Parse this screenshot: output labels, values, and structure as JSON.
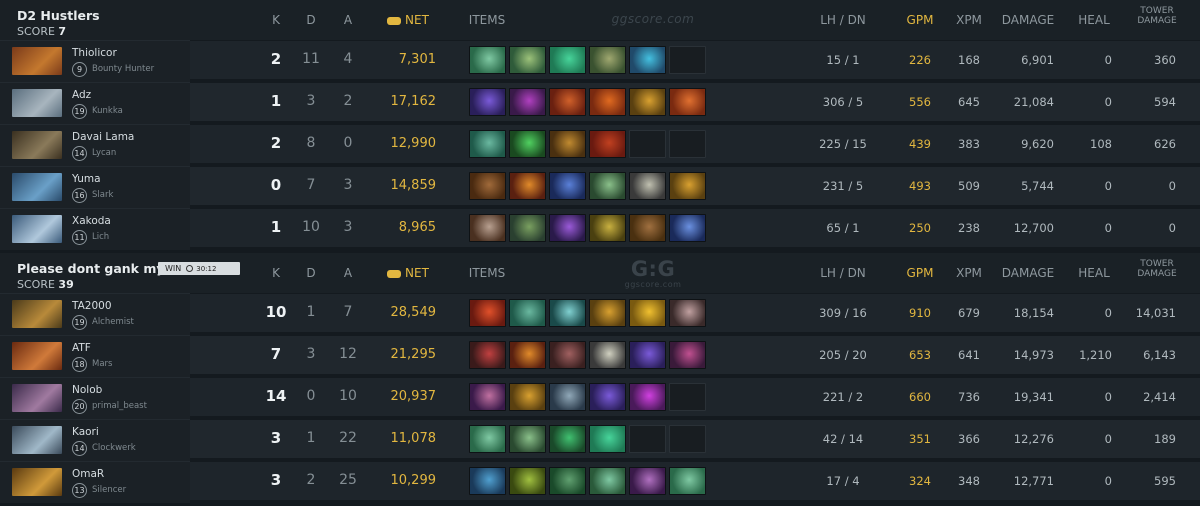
{
  "columns": {
    "k": "K",
    "d": "D",
    "a": "A",
    "net": "NET",
    "items": "ITEMS",
    "lh_dn": "LH  /  DN",
    "gpm": "GPM",
    "xpm": "XPM",
    "damage": "DAMAGE",
    "heal": "HEAL",
    "tower_damage_line1": "TOWER",
    "tower_damage_line2": "DAMAGE"
  },
  "watermark": {
    "top": "ggscore.com",
    "logo": "G:G",
    "logo_sub": "ggscore.com"
  },
  "match": {
    "result": "WIN",
    "duration": "30:12"
  },
  "colors": {
    "gold": "#e2b740",
    "background": "#141a1f",
    "row": "#1e252b"
  },
  "teams": [
    {
      "name": "D2 Hustlers",
      "score_label": "SCORE",
      "score": "7",
      "players": [
        {
          "name": "Thiolicor",
          "level": "9",
          "hero": "Bounty Hunter",
          "k": "2",
          "d": "11",
          "a": "4",
          "net": "7,301",
          "lh_dn": "15  /  1",
          "gpm": "226",
          "xpm": "168",
          "damage": "6,901",
          "heal": "0",
          "tower": "360",
          "portrait_colors": [
            "#7a3a1a",
            "#c4782e"
          ],
          "items": [
            [
              "#2a6a4a",
              "#7fc9a3"
            ],
            [
              "#2f5b3a",
              "#9cc27a"
            ],
            [
              "#1f7a55",
              "#47d49a"
            ],
            [
              "#3a5230",
              "#a0a870"
            ],
            [
              "#204a6a",
              "#44c0e0"
            ],
            null
          ]
        },
        {
          "name": "Adz",
          "level": "19",
          "hero": "Kunkka",
          "k": "1",
          "d": "3",
          "a": "2",
          "net": "17,162",
          "lh_dn": "306  /  5",
          "gpm": "556",
          "xpm": "645",
          "damage": "21,084",
          "heal": "0",
          "tower": "594",
          "portrait_colors": [
            "#5a6e7e",
            "#a8b5be"
          ],
          "items": [
            [
              "#2a1f5a",
              "#7a5ad8"
            ],
            [
              "#3a1a4a",
              "#b040c0"
            ],
            [
              "#6a2010",
              "#d0602a"
            ],
            [
              "#7a2a10",
              "#e06a20"
            ],
            [
              "#5a4010",
              "#d8a030"
            ],
            [
              "#7a2a10",
              "#e07030"
            ]
          ]
        },
        {
          "name": "Davai Lama",
          "level": "14",
          "hero": "Lycan",
          "k": "2",
          "d": "8",
          "a": "0",
          "net": "12,990",
          "lh_dn": "225  /  15",
          "gpm": "439",
          "xpm": "383",
          "damage": "9,620",
          "heal": "108",
          "tower": "626",
          "portrait_colors": [
            "#3a3020",
            "#8a7a5a"
          ],
          "items": [
            [
              "#1f5a4a",
              "#6ab8a0"
            ],
            [
              "#1a4a20",
              "#50d060"
            ],
            [
              "#4a3010",
              "#c08a30"
            ],
            [
              "#6a1a10",
              "#c04020"
            ],
            null,
            null
          ]
        },
        {
          "name": "Yuma",
          "level": "16",
          "hero": "Slark",
          "k": "0",
          "d": "7",
          "a": "3",
          "net": "14,859",
          "lh_dn": "231  /  5",
          "gpm": "493",
          "xpm": "509",
          "damage": "5,744",
          "heal": "0",
          "tower": "0",
          "portrait_colors": [
            "#2a4a6a",
            "#6aa0c8"
          ],
          "items": [
            [
              "#4a2a10",
              "#a06a3a"
            ],
            [
              "#5a2010",
              "#e08a2a"
            ],
            [
              "#1a2a5a",
              "#5a80d8"
            ],
            [
              "#2a4a30",
              "#8ac08a"
            ],
            [
              "#3a3a3a",
              "#c0c0b0"
            ],
            [
              "#5a4010",
              "#d8a030"
            ]
          ]
        },
        {
          "name": "Xakoda",
          "level": "11",
          "hero": "Lich",
          "k": "1",
          "d": "10",
          "a": "3",
          "net": "8,965",
          "lh_dn": "65  /  1",
          "gpm": "250",
          "xpm": "238",
          "damage": "12,700",
          "heal": "0",
          "tower": "0",
          "portrait_colors": [
            "#3a5a7a",
            "#b0c8dc"
          ],
          "items": [
            [
              "#4a3020",
              "#b8a090"
            ],
            [
              "#2a4030",
              "#7aa060"
            ],
            [
              "#2a1a4a",
              "#9a5ad8"
            ],
            [
              "#4a4010",
              "#c8b040"
            ],
            [
              "#4a3010",
              "#a07040"
            ],
            [
              "#1a2a5a",
              "#6a90e0"
            ]
          ]
        }
      ]
    },
    {
      "name": "Please dont gank my carry",
      "score_label": "SCORE",
      "score": "39",
      "players": [
        {
          "name": "TA2000",
          "level": "19",
          "hero": "Alchemist",
          "k": "10",
          "d": "1",
          "a": "7",
          "net": "28,549",
          "lh_dn": "309  /  16",
          "gpm": "910",
          "xpm": "679",
          "damage": "18,154",
          "heal": "0",
          "tower": "14,031",
          "portrait_colors": [
            "#4a3a1a",
            "#b88a3a"
          ],
          "items": [
            [
              "#6a1a10",
              "#e0502a"
            ],
            [
              "#1f5a4a",
              "#6ab8a0"
            ],
            [
              "#1a4a4a",
              "#80d0d0"
            ],
            [
              "#5a4010",
              "#d8a030"
            ],
            [
              "#7a5a10",
              "#f0c030"
            ],
            [
              "#3a2a2a",
              "#c0a0a0"
            ]
          ]
        },
        {
          "name": "ATF",
          "level": "18",
          "hero": "Mars",
          "k": "7",
          "d": "3",
          "a": "12",
          "net": "21,295",
          "lh_dn": "205  /  20",
          "gpm": "653",
          "xpm": "641",
          "damage": "14,973",
          "heal": "1,210",
          "tower": "6,143",
          "portrait_colors": [
            "#6a2a10",
            "#d07a3a"
          ],
          "items": [
            [
              "#3a1a1a",
              "#c04040"
            ],
            [
              "#5a2010",
              "#e08a2a"
            ],
            [
              "#3a2020",
              "#a06060"
            ],
            [
              "#3a3a3a",
              "#d0d0c0"
            ],
            [
              "#2a1f5a",
              "#7a5ad8"
            ],
            [
              "#3a1a3a",
              "#c05090"
            ]
          ]
        },
        {
          "name": "Nolob",
          "level": "20",
          "hero": "primal_beast",
          "k": "14",
          "d": "0",
          "a": "10",
          "net": "20,937",
          "lh_dn": "221  /  2",
          "gpm": "660",
          "xpm": "736",
          "damage": "19,341",
          "heal": "0",
          "tower": "2,414",
          "portrait_colors": [
            "#3a2a4a",
            "#a07aa0"
          ],
          "items": [
            [
              "#3a1a4a",
              "#c070a0"
            ],
            [
              "#5a4010",
              "#d8a030"
            ],
            [
              "#2a3a4a",
              "#90a8b8"
            ],
            [
              "#2a1f5a",
              "#7a5ad8"
            ],
            [
              "#4a1a5a",
              "#d040e0"
            ],
            null
          ]
        },
        {
          "name": "Kaori",
          "level": "14",
          "hero": "Clockwerk",
          "k": "3",
          "d": "1",
          "a": "22",
          "net": "11,078",
          "lh_dn": "42  /  14",
          "gpm": "351",
          "xpm": "366",
          "damage": "12,276",
          "heal": "0",
          "tower": "189",
          "portrait_colors": [
            "#3a4a5a",
            "#a0b8c8"
          ],
          "items": [
            [
              "#2a6a4a",
              "#7fc9a3"
            ],
            [
              "#2a4a30",
              "#8ac08a"
            ],
            [
              "#1a4a2a",
              "#40c070"
            ],
            [
              "#1f7a55",
              "#47d49a"
            ],
            null,
            null
          ]
        },
        {
          "name": "OmaR",
          "level": "13",
          "hero": "Silencer",
          "k": "3",
          "d": "2",
          "a": "25",
          "net": "10,299",
          "lh_dn": "17  /  4",
          "gpm": "324",
          "xpm": "348",
          "damage": "12,771",
          "heal": "0",
          "tower": "595",
          "portrait_colors": [
            "#5a3a10",
            "#d09a3a"
          ],
          "items": [
            [
              "#1a3a5a",
              "#50a0d0"
            ],
            [
              "#3a4a10",
              "#a0c040"
            ],
            [
              "#1a4a2a",
              "#60a070"
            ],
            [
              "#2a5a3a",
              "#7fc9a3"
            ],
            [
              "#3a1a4a",
              "#b070c0"
            ],
            [
              "#2a6a4a",
              "#7fc9a3"
            ]
          ]
        }
      ]
    }
  ]
}
